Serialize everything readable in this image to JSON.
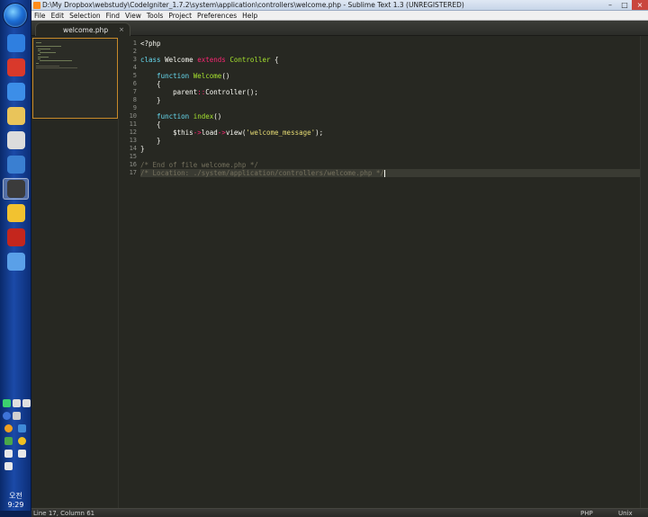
{
  "window": {
    "title": "D:\\My Dropbox\\webstudy\\CodeIgniter_1.7.2\\system\\application\\controllers\\welcome.php - Sublime Text 1.3 (UNREGISTERED)"
  },
  "menu": [
    "File",
    "Edit",
    "Selection",
    "Find",
    "View",
    "Tools",
    "Project",
    "Preferences",
    "Help"
  ],
  "tab": {
    "label": "welcome.php",
    "close": "×"
  },
  "editor": {
    "lines": [
      {
        "n": "1",
        "tokens": [
          {
            "t": "<?php",
            "c": "plain"
          }
        ]
      },
      {
        "n": "2",
        "tokens": []
      },
      {
        "n": "3",
        "tokens": [
          {
            "t": "class ",
            "c": "kw"
          },
          {
            "t": "Welcome ",
            "c": "plain"
          },
          {
            "t": "extends ",
            "c": "red"
          },
          {
            "t": "Controller ",
            "c": "cls"
          },
          {
            "t": "{",
            "c": "plain"
          }
        ]
      },
      {
        "n": "4",
        "tokens": []
      },
      {
        "n": "5",
        "tokens": [
          {
            "t": "    function ",
            "c": "kw"
          },
          {
            "t": "Welcome",
            "c": "cls"
          },
          {
            "t": "()",
            "c": "plain"
          }
        ]
      },
      {
        "n": "6",
        "tokens": [
          {
            "t": "    {",
            "c": "plain"
          }
        ]
      },
      {
        "n": "7",
        "tokens": [
          {
            "t": "        parent",
            "c": "plain"
          },
          {
            "t": "::",
            "c": "red"
          },
          {
            "t": "Controller();",
            "c": "plain"
          }
        ]
      },
      {
        "n": "8",
        "tokens": [
          {
            "t": "    }",
            "c": "plain"
          }
        ]
      },
      {
        "n": "9",
        "tokens": []
      },
      {
        "n": "10",
        "tokens": [
          {
            "t": "    function ",
            "c": "kw"
          },
          {
            "t": "index",
            "c": "cls"
          },
          {
            "t": "()",
            "c": "plain"
          }
        ]
      },
      {
        "n": "11",
        "tokens": [
          {
            "t": "    {",
            "c": "plain"
          }
        ]
      },
      {
        "n": "12",
        "tokens": [
          {
            "t": "        $this",
            "c": "plain"
          },
          {
            "t": "->",
            "c": "red"
          },
          {
            "t": "load",
            "c": "plain"
          },
          {
            "t": "->",
            "c": "red"
          },
          {
            "t": "view(",
            "c": "plain"
          },
          {
            "t": "'welcome_message'",
            "c": "str"
          },
          {
            "t": ");",
            "c": "plain"
          }
        ]
      },
      {
        "n": "13",
        "tokens": [
          {
            "t": "    }",
            "c": "plain"
          }
        ]
      },
      {
        "n": "14",
        "tokens": [
          {
            "t": "}",
            "c": "plain"
          }
        ]
      },
      {
        "n": "15",
        "tokens": []
      },
      {
        "n": "16",
        "tokens": [
          {
            "t": "/* End of file welcome.php */",
            "c": "cm"
          }
        ]
      },
      {
        "n": "17",
        "tokens": [
          {
            "t": "/* Location: ./system/application/controllers/welcome.php */",
            "c": "cm"
          }
        ],
        "current": true
      }
    ]
  },
  "status": {
    "position": "Line 17, Column 61",
    "syntax": "PHP",
    "line_endings": "Unix"
  },
  "taskbar": {
    "clock": "오전 9:29",
    "apps": [
      {
        "name": "ie-icon",
        "color": "#2f7fe0"
      },
      {
        "name": "chrome-icon",
        "color": "#d9392b"
      },
      {
        "name": "document-app-icon",
        "color": "#3c8ee8"
      },
      {
        "name": "folder-icon",
        "color": "#e9c45a"
      },
      {
        "name": "panda-app-icon",
        "color": "#dcdcdc"
      },
      {
        "name": "dolphin-icon",
        "color": "#3a7fd1"
      },
      {
        "name": "sublime-text-icon",
        "color": "#3b3b3b"
      },
      {
        "name": "messenger-icon",
        "color": "#f2c230"
      },
      {
        "name": "filezilla-icon",
        "color": "#c4261d"
      },
      {
        "name": "browser-icon",
        "color": "#5aa0e8"
      }
    ]
  }
}
